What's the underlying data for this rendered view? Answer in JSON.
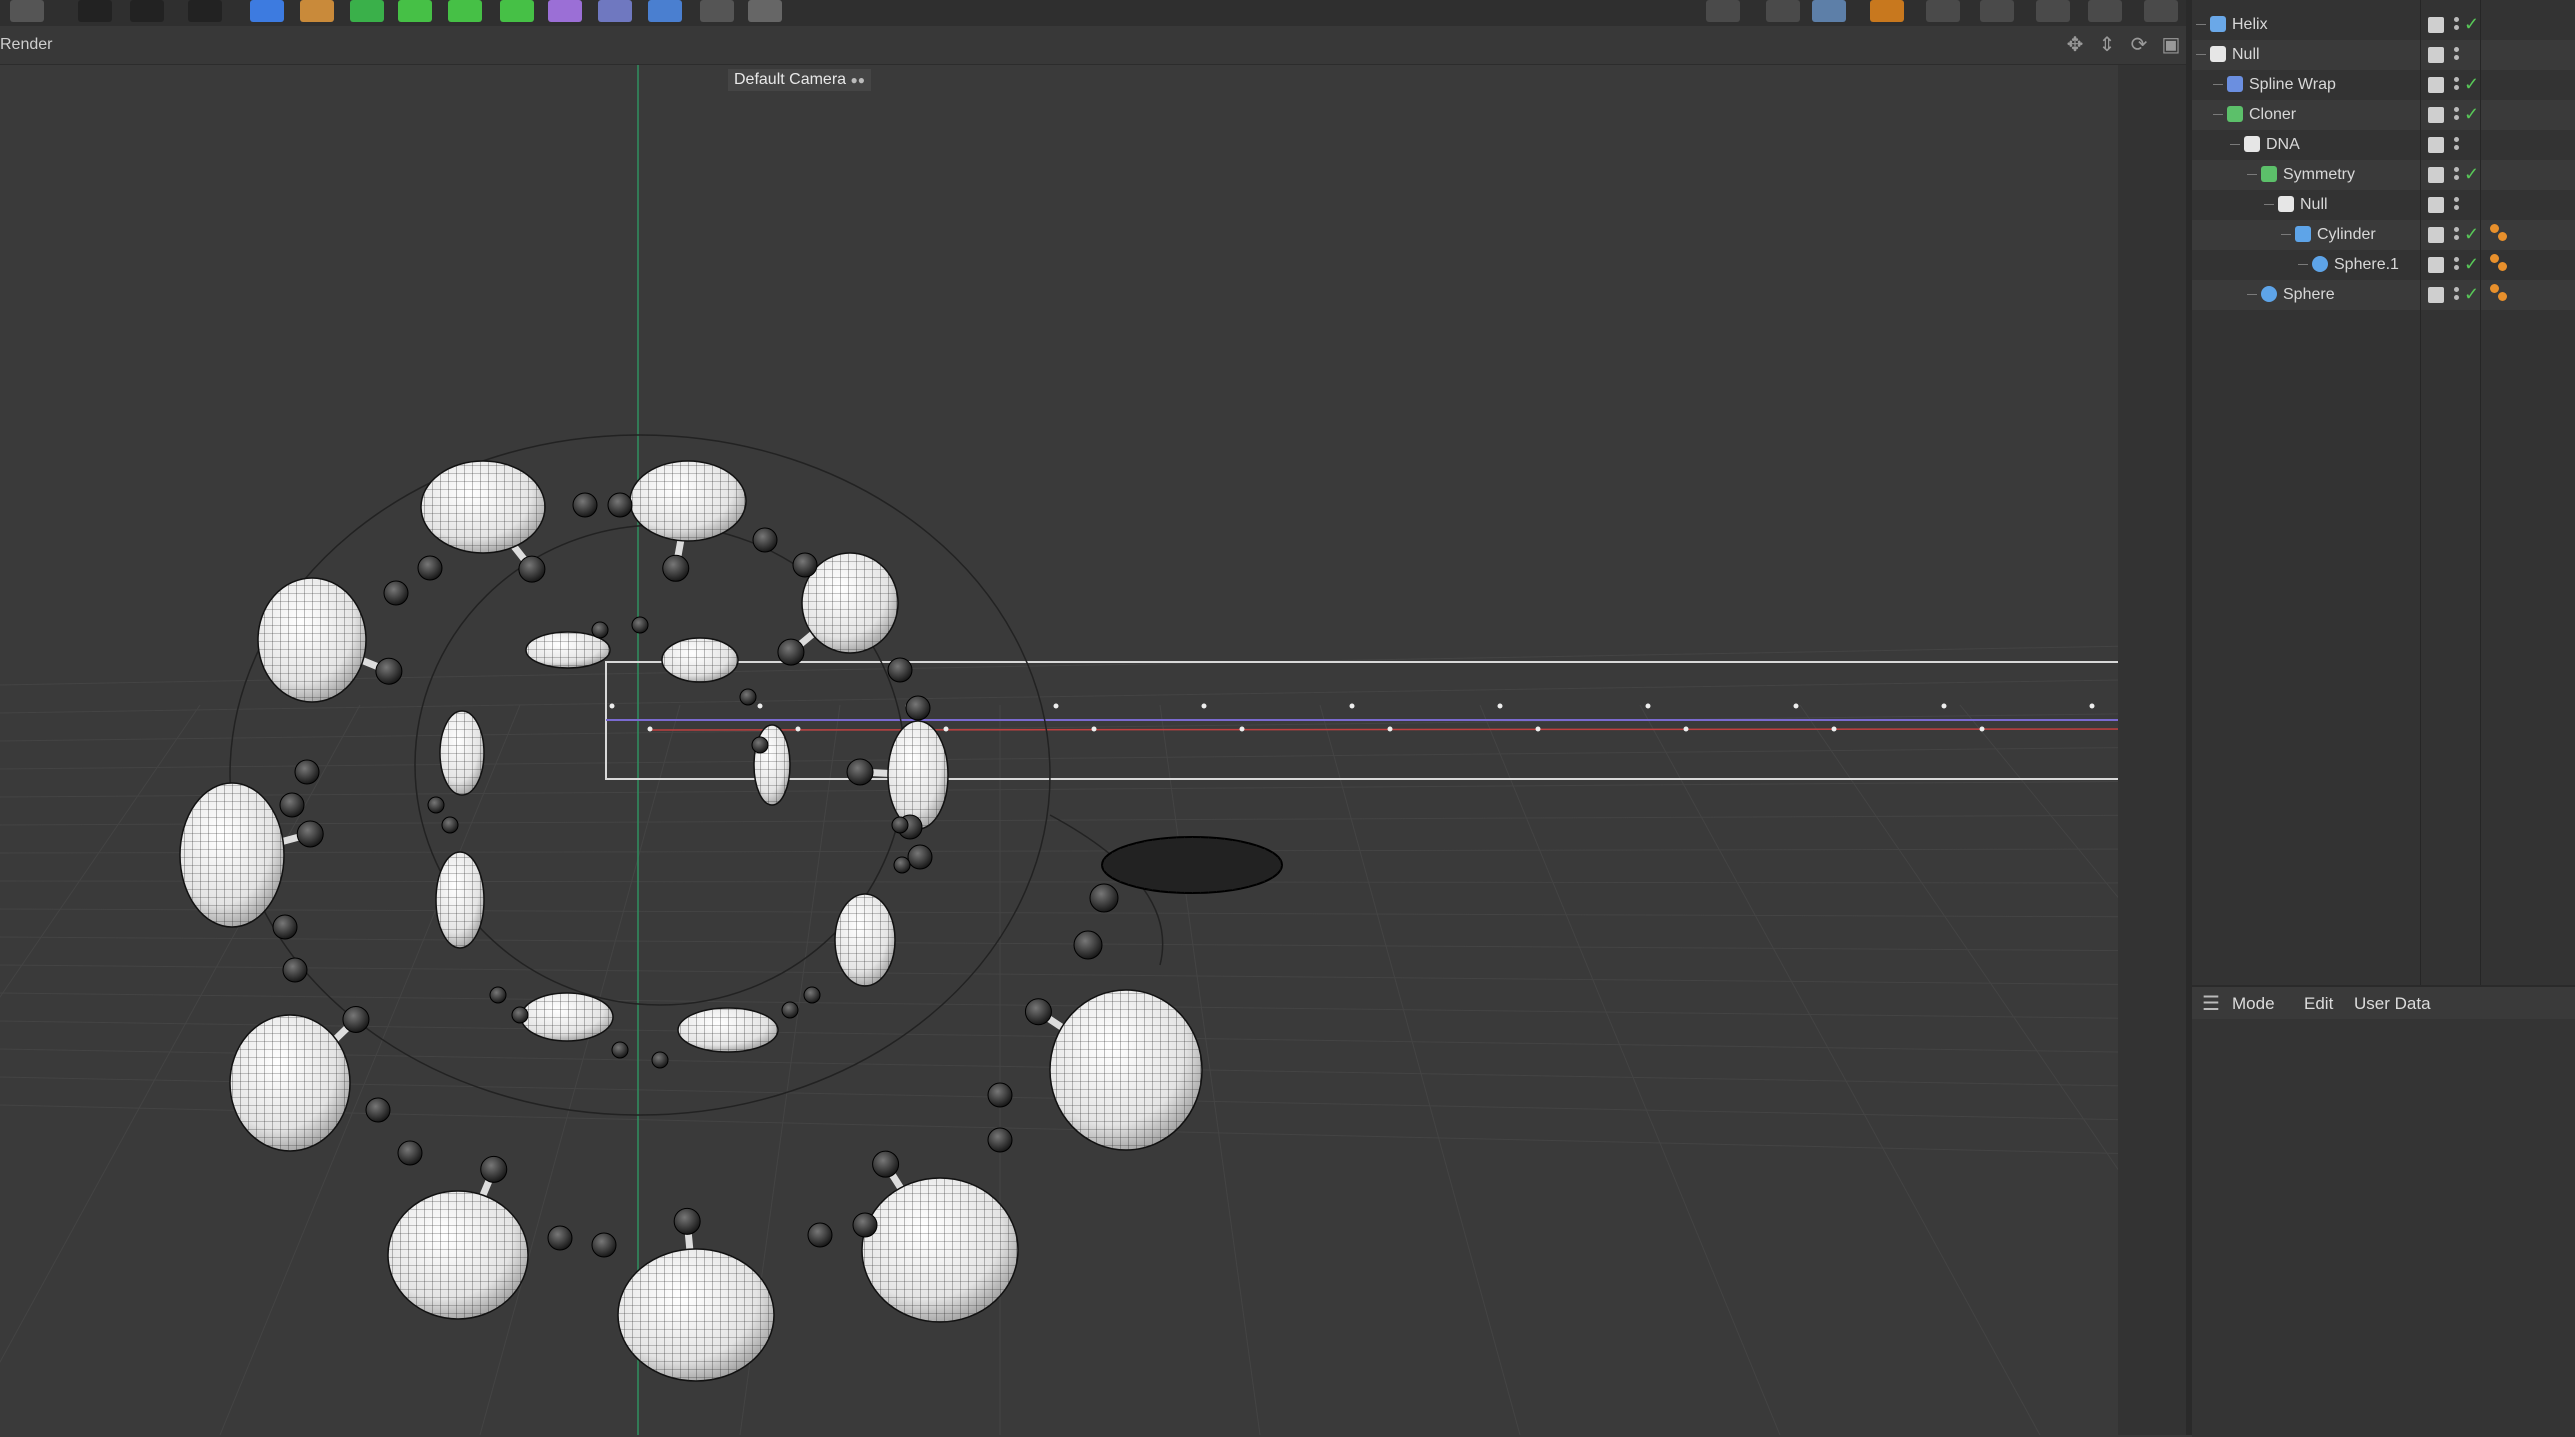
{
  "toolbar": {
    "icons": [
      "file-icon",
      "render-region-icon",
      "render-view-icon",
      "render-settings-icon",
      "cube-icon",
      "pen-icon",
      "subdivision-icon",
      "extrude-icon",
      "cloner-icon",
      "mograph-array-icon",
      "bend-icon",
      "sculpt-icon",
      "floor-icon",
      "camera-icon",
      "light-icon"
    ],
    "right_icons": [
      "lock-icon",
      "light-bulb-icon",
      "snap-icon",
      "magnet-icon",
      "axis-icon",
      "workplane-icon",
      "render-icon",
      "grid-icon",
      "gear-icon"
    ]
  },
  "viewport": {
    "menu_label": "Render",
    "camera_label": "Default Camera",
    "camera_icon": "camera-dots-icon",
    "nav_icons": [
      "move-icon",
      "zoom-icon",
      "rotate-icon",
      "maximize-icon"
    ]
  },
  "object_manager": {
    "rows": [
      {
        "name": "Helix",
        "icon": "helix-icon",
        "color": "#6aa8e8",
        "depth": 0,
        "check": true,
        "tag": false
      },
      {
        "name": "Null",
        "icon": "null-icon",
        "color": "#e6e6e6",
        "depth": 0,
        "check": false,
        "tag": false
      },
      {
        "name": "Spline Wrap",
        "icon": "spline-wrap-icon",
        "color": "#6b8fe0",
        "depth": 1,
        "check": true,
        "tag": false
      },
      {
        "name": "Cloner",
        "icon": "cloner-icon",
        "color": "#5cc06a",
        "depth": 1,
        "check": true,
        "tag": false
      },
      {
        "name": "DNA",
        "icon": "null-icon",
        "color": "#e6e6e6",
        "depth": 2,
        "check": false,
        "tag": false
      },
      {
        "name": "Symmetry",
        "icon": "symmetry-icon",
        "color": "#5cc06a",
        "depth": 3,
        "check": true,
        "tag": false
      },
      {
        "name": "Null",
        "icon": "null-icon",
        "color": "#e6e6e6",
        "depth": 4,
        "check": false,
        "tag": false
      },
      {
        "name": "Cylinder",
        "icon": "cylinder-icon",
        "color": "#5ea4e8",
        "depth": 5,
        "check": true,
        "tag": true
      },
      {
        "name": "Sphere.1",
        "icon": "sphere-icon",
        "color": "#5ea4e8",
        "depth": 6,
        "check": true,
        "tag": true
      },
      {
        "name": "Sphere",
        "icon": "sphere-icon",
        "color": "#5ea4e8",
        "depth": 3,
        "check": true,
        "tag": true
      }
    ]
  },
  "attribute_manager": {
    "menu_icon": "hamburger-icon",
    "menu": [
      "Mode",
      "Edit",
      "User Data"
    ]
  }
}
